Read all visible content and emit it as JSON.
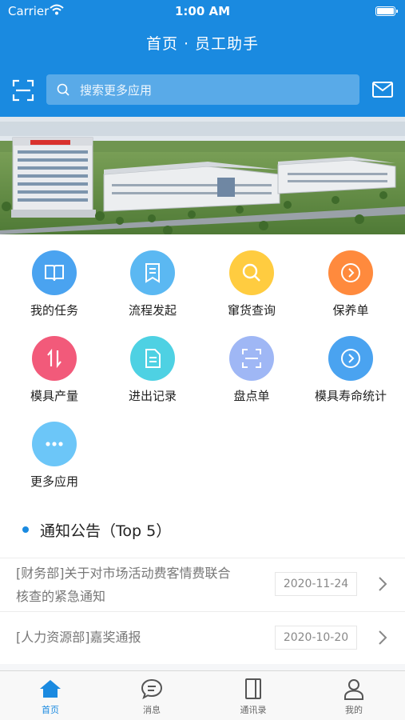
{
  "status_bar": {
    "carrier": "Carrier",
    "time": "1:00 AM"
  },
  "header": {
    "title": "首页 · 员工助手"
  },
  "search": {
    "placeholder": "搜索更多应用"
  },
  "apps": [
    {
      "label": "我的任务",
      "icon": "book-icon",
      "color": "#4aa3f0"
    },
    {
      "label": "流程发起",
      "icon": "document-list-icon",
      "color": "#5bb8f2"
    },
    {
      "label": "窜货查询",
      "icon": "search-icon",
      "color": "#ffcc40"
    },
    {
      "label": "保养单",
      "icon": "arrow-right-circle-icon",
      "color": "#ff8a3d"
    },
    {
      "label": "模具产量",
      "icon": "up-down-arrows-icon",
      "color": "#f25a7a"
    },
    {
      "label": "进出记录",
      "icon": "document-icon",
      "color": "#4ed1e3"
    },
    {
      "label": "盘点单",
      "icon": "scan-icon",
      "color": "#9fb7f5"
    },
    {
      "label": "模具寿命统计",
      "icon": "arrow-right-circle-icon",
      "color": "#4aa3f0"
    },
    {
      "label": "更多应用",
      "icon": "more-icon",
      "color": "#6cc6f8"
    }
  ],
  "notice": {
    "title": "通知公告（Top 5）",
    "items": [
      {
        "text_line1": "[财务部]关于对市场活动费客情费联合",
        "text_line2": "核查的紧急通知",
        "date": "2020-11-24"
      },
      {
        "text_line1": "[人力资源部]嘉奖通报",
        "date": "2020-10-20"
      }
    ]
  },
  "tabs": [
    {
      "label": "首页",
      "icon": "home-icon"
    },
    {
      "label": "消息",
      "icon": "message-icon"
    },
    {
      "label": "通讯录",
      "icon": "contacts-icon"
    },
    {
      "label": "我的",
      "icon": "user-icon"
    }
  ],
  "colors": {
    "primary": "#1a8ae0"
  }
}
